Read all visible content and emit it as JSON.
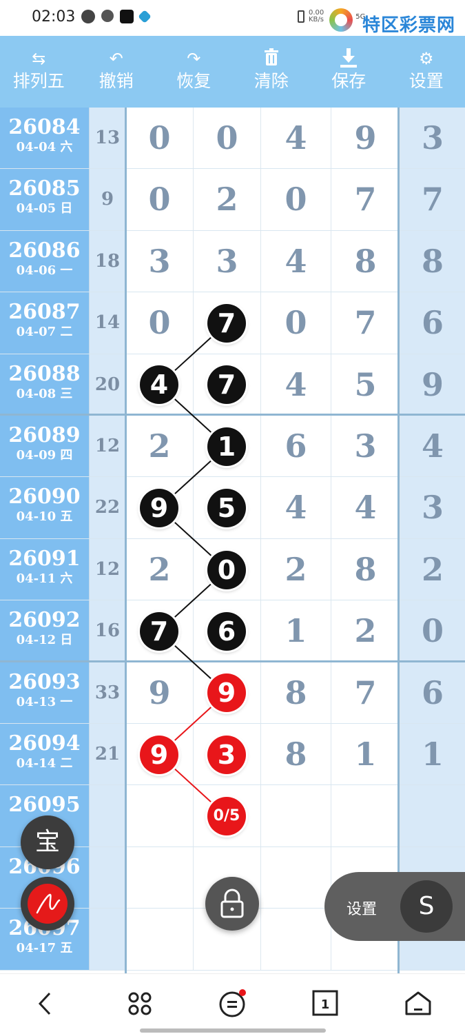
{
  "status_bar": {
    "time": "02:03",
    "net_speed_value": "0.00",
    "net_speed_unit": "KB/s",
    "signal": "5G",
    "watermark": "特区彩票网"
  },
  "toolbar": {
    "items": [
      {
        "label": "排列五",
        "icon": "swap-arrows-icon"
      },
      {
        "label": "撤销",
        "icon": "undo-icon"
      },
      {
        "label": "恢复",
        "icon": "redo-icon"
      },
      {
        "label": "清除",
        "icon": "trash-icon"
      },
      {
        "label": "保存",
        "icon": "download-icon"
      },
      {
        "label": "设置",
        "icon": "gear-icon"
      }
    ]
  },
  "rows": [
    {
      "issue": "26084",
      "date": "04-04 六",
      "sum": "13",
      "digits": [
        "0",
        "0",
        "4",
        "9",
        "3"
      ]
    },
    {
      "issue": "26085",
      "date": "04-05 日",
      "sum": "9",
      "digits": [
        "0",
        "2",
        "0",
        "7",
        "7"
      ]
    },
    {
      "issue": "26086",
      "date": "04-06 一",
      "sum": "18",
      "digits": [
        "3",
        "3",
        "4",
        "8",
        "8"
      ]
    },
    {
      "issue": "26087",
      "date": "04-07 二",
      "sum": "14",
      "digits": [
        "0",
        "7",
        "0",
        "7",
        "6"
      ]
    },
    {
      "issue": "26088",
      "date": "04-08 三",
      "sum": "20",
      "digits": [
        "4",
        "7",
        "4",
        "5",
        "9"
      ]
    },
    {
      "issue": "26089",
      "date": "04-09 四",
      "sum": "12",
      "digits": [
        "2",
        "1",
        "6",
        "3",
        "4"
      ]
    },
    {
      "issue": "26090",
      "date": "04-10 五",
      "sum": "22",
      "digits": [
        "9",
        "5",
        "4",
        "4",
        "3"
      ]
    },
    {
      "issue": "26091",
      "date": "04-11 六",
      "sum": "12",
      "digits": [
        "2",
        "0",
        "2",
        "8",
        "2"
      ]
    },
    {
      "issue": "26092",
      "date": "04-12 日",
      "sum": "16",
      "digits": [
        "7",
        "6",
        "1",
        "2",
        "0"
      ]
    },
    {
      "issue": "26093",
      "date": "04-13 一",
      "sum": "33",
      "digits": [
        "9",
        "9",
        "8",
        "7",
        "6"
      ]
    },
    {
      "issue": "26094",
      "date": "04-14 二",
      "sum": "21",
      "digits": [
        "9",
        "3",
        "8",
        "1",
        "1"
      ]
    },
    {
      "issue": "26095",
      "date": "",
      "sum": "",
      "digits": [
        "",
        "",
        "",
        "",
        ""
      ]
    },
    {
      "issue": "26096",
      "date": "",
      "sum": "",
      "digits": [
        "",
        "",
        "",
        "",
        ""
      ]
    },
    {
      "issue": "26097",
      "date": "04-17 五",
      "sum": "",
      "digits": [
        "",
        "",
        "",
        "",
        ""
      ]
    }
  ],
  "markers": [
    {
      "row": 3,
      "col": 1,
      "text": "7",
      "color": "black"
    },
    {
      "row": 4,
      "col": 0,
      "text": "4",
      "color": "black"
    },
    {
      "row": 4,
      "col": 1,
      "text": "7",
      "color": "black"
    },
    {
      "row": 5,
      "col": 1,
      "text": "1",
      "color": "black"
    },
    {
      "row": 6,
      "col": 0,
      "text": "9",
      "color": "black"
    },
    {
      "row": 6,
      "col": 1,
      "text": "5",
      "color": "black"
    },
    {
      "row": 7,
      "col": 1,
      "text": "0",
      "color": "black"
    },
    {
      "row": 8,
      "col": 0,
      "text": "7",
      "color": "black"
    },
    {
      "row": 8,
      "col": 1,
      "text": "6",
      "color": "black"
    },
    {
      "row": 9,
      "col": 1,
      "text": "9",
      "color": "red"
    },
    {
      "row": 10,
      "col": 0,
      "text": "9",
      "color": "red"
    },
    {
      "row": 10,
      "col": 1,
      "text": "3",
      "color": "red"
    },
    {
      "row": 11,
      "col": 1,
      "text": "0/5",
      "color": "red"
    }
  ],
  "connector_path": [
    {
      "row": 3,
      "col": 1,
      "color": "black"
    },
    {
      "row": 4,
      "col": 0,
      "color": "black"
    },
    {
      "row": 5,
      "col": 1,
      "color": "black"
    },
    {
      "row": 6,
      "col": 0,
      "color": "black"
    },
    {
      "row": 7,
      "col": 1,
      "color": "black"
    },
    {
      "row": 8,
      "col": 0,
      "color": "black"
    },
    {
      "row": 9,
      "col": 1,
      "color": "black"
    },
    {
      "row": 10,
      "col": 0,
      "color": "red"
    },
    {
      "row": 11,
      "col": 1,
      "color": "red"
    }
  ],
  "floating": {
    "bao_label": "宝",
    "settings_label": "设置",
    "s_label": "S"
  },
  "colors": {
    "header_blue": "#8cc9f2",
    "issue_blue": "#7fbef0",
    "marker_red": "#e8161a",
    "marker_black": "#111111"
  }
}
